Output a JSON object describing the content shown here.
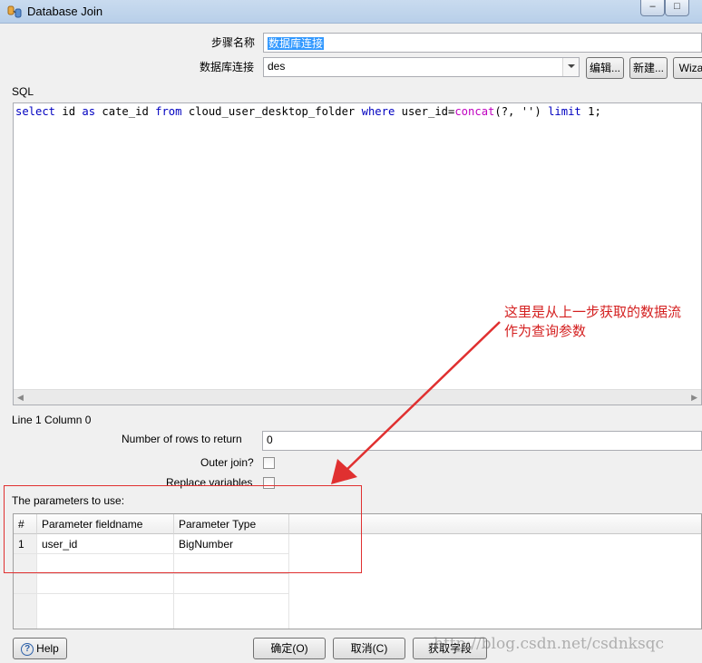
{
  "window": {
    "title": "Database Join",
    "min_glyph": "–",
    "max_glyph": "□"
  },
  "form": {
    "step_name_label": "步骤名称",
    "step_name_value": "数据库连接",
    "connection_label": "数据库连接",
    "connection_value": "des",
    "edit_button": "编辑...",
    "new_button": "新建...",
    "wizard_button": "Wiza"
  },
  "sql": {
    "label": "SQL",
    "tokens": [
      {
        "t": "select",
        "k": "kw"
      },
      {
        "t": " id ",
        "k": ""
      },
      {
        "t": "as",
        "k": "kw"
      },
      {
        "t": " cate_id ",
        "k": ""
      },
      {
        "t": "from",
        "k": "kw"
      },
      {
        "t": " cloud_user_desktop_folder ",
        "k": ""
      },
      {
        "t": "where",
        "k": "kw"
      },
      {
        "t": " user_id=",
        "k": ""
      },
      {
        "t": "concat",
        "k": "fn"
      },
      {
        "t": "(?, '') ",
        "k": ""
      },
      {
        "t": "limit",
        "k": "kw"
      },
      {
        "t": " 1;",
        "k": ""
      }
    ],
    "status": "Line 1 Column 0"
  },
  "options": {
    "rows_label": "Number of rows to return",
    "rows_value": "0",
    "outer_join_label": "Outer join?",
    "replace_vars_label": "Replace variables"
  },
  "params": {
    "label": "The parameters to use:",
    "columns": [
      "#",
      "Parameter fieldname",
      "Parameter Type"
    ],
    "rows": [
      {
        "num": "1",
        "field": "user_id",
        "type": "BigNumber"
      }
    ]
  },
  "buttons": {
    "help": "Help",
    "ok": "确定(O)",
    "cancel": "取消(C)",
    "get_fields": "获取字段"
  },
  "annotation": {
    "line1": "这里是从上一步获取的数据流",
    "line2": "作为查询参数",
    "color": "#d42020"
  },
  "watermark": "http://blog.csdn.net/csdnksqc"
}
